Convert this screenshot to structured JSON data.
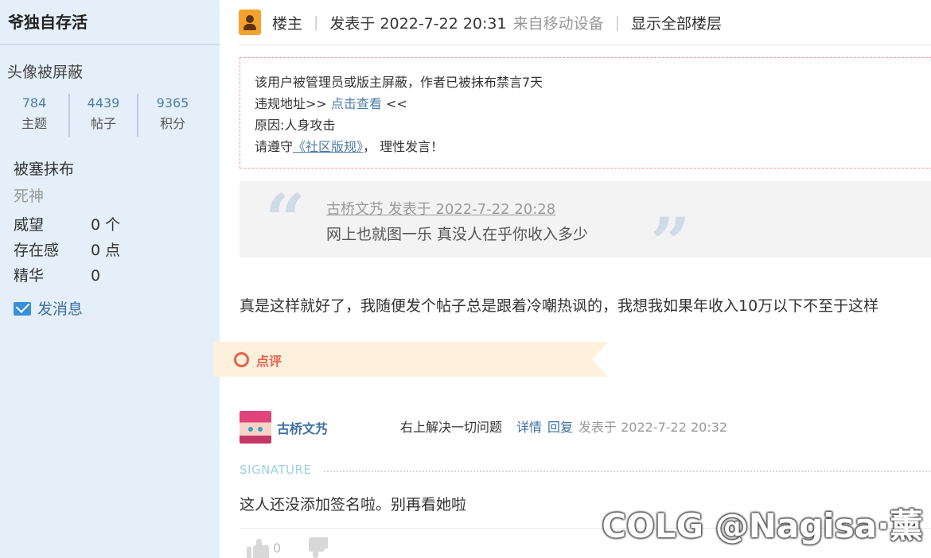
{
  "sidebar": {
    "username": "爷独自存活",
    "avatar_blocked": "头像被屏蔽",
    "stats": [
      {
        "value": "784",
        "label": "主题"
      },
      {
        "value": "4439",
        "label": "帖子"
      },
      {
        "value": "9365",
        "label": "积分"
      }
    ],
    "status": "被塞抹布",
    "rank": "死神",
    "attributes": [
      {
        "key": "威望",
        "value": "0 个"
      },
      {
        "key": "存在感",
        "value": "0 点"
      },
      {
        "key": "精华",
        "value": "0"
      }
    ],
    "message_label": "发消息"
  },
  "post": {
    "host_label": "楼主",
    "posted_label": "发表于 2022-7-22 20:31",
    "device_label": "来自移动设备",
    "show_all_label": "显示全部楼层",
    "notice": {
      "line1": "该用户被管理员或版主屏蔽，作者已被抹布禁言7天",
      "line2_prefix": "违规地址>> ",
      "line2_link": "点击查看",
      "line2_suffix": " <<",
      "line3": "原因:人身攻击",
      "line4_prefix": "请遵守",
      "line4_link": "《社区版规》",
      "line4_suffix": "， 理性发言！"
    },
    "quote": {
      "open_mark": "“",
      "close_mark": "”",
      "header": "古桥文艿 发表于 2022-7-22 20:28",
      "body": "网上也就图一乐 真没人在乎你收入多少"
    },
    "reply_text": "真是这样就好了，我随便发个帖子总是跟着冷嘲热讽的，我想我如果年收入10万以下不至于这样"
  },
  "comments": {
    "section_label": "点评",
    "items": [
      {
        "user": "古桥文艿",
        "text": "右上解决一切问题",
        "detail_label": "详情",
        "reply_label": "回复",
        "time": "发表于 2022-7-22 20:32"
      }
    ]
  },
  "signature": {
    "label": "SIGNATURE",
    "text": "这人还没添加签名啦。别再看她啦"
  },
  "votes": {
    "like_count": "0"
  },
  "watermark": "COLG @Nagisa·薰",
  "colors": {
    "sidebar_bg": "#e5effa",
    "link": "#3d6fa3",
    "notice_border": "#f09a9a",
    "comment_accent": "#e8604c",
    "comment_bar_bg": "#fdf1dc"
  }
}
